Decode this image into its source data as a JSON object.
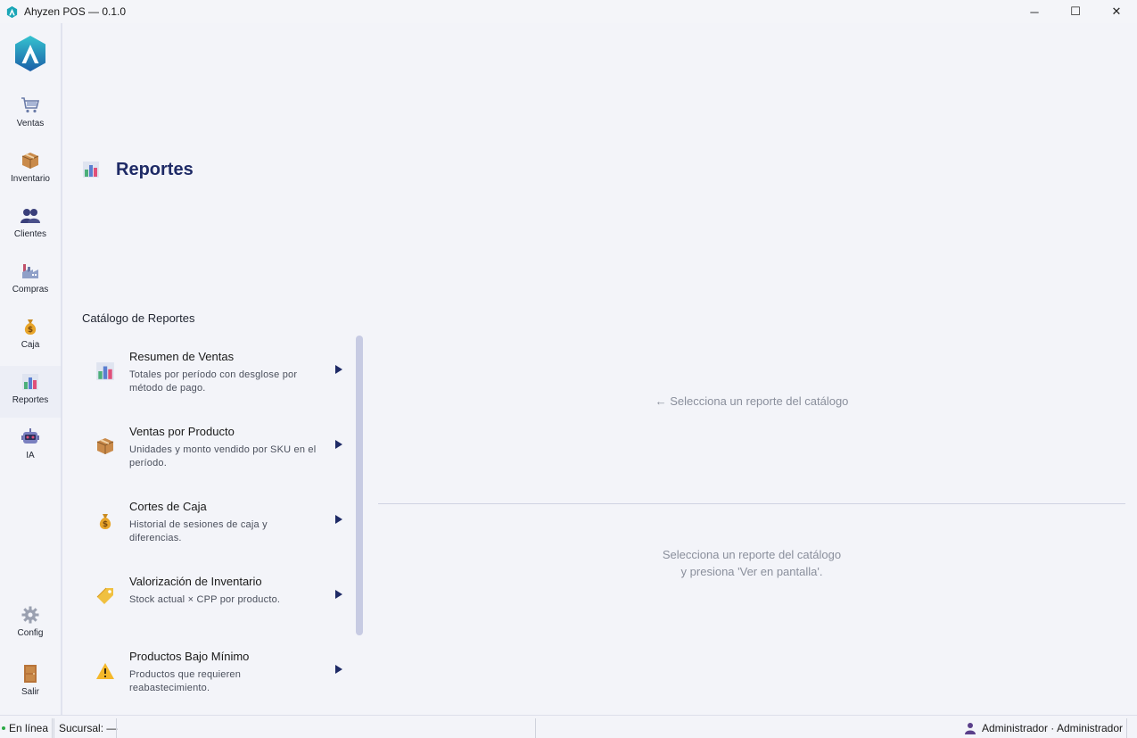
{
  "window": {
    "title": "Ahyzen POS — 0.1.0",
    "minimize": "─",
    "maximize": "☐",
    "close": "✕"
  },
  "sidebar": {
    "items": [
      {
        "label": "Ventas",
        "icon": "cart-icon"
      },
      {
        "label": "Inventario",
        "icon": "package-icon"
      },
      {
        "label": "Clientes",
        "icon": "users-icon"
      },
      {
        "label": "Compras",
        "icon": "factory-icon"
      },
      {
        "label": "Caja",
        "icon": "money-bag-icon"
      },
      {
        "label": "Reportes",
        "icon": "bar-chart-icon",
        "active": true
      },
      {
        "label": "IA",
        "icon": "robot-icon"
      }
    ],
    "bottom_items": [
      {
        "label": "Config",
        "icon": "gear-icon"
      },
      {
        "label": "Salir",
        "icon": "door-icon"
      }
    ]
  },
  "header": {
    "title": "Reportes"
  },
  "catalog": {
    "label": "Catálogo de Reportes",
    "reports": [
      {
        "name": "Resumen de Ventas",
        "desc": "Totales por período con desglose por método de pago.",
        "icon": "bar-chart-icon"
      },
      {
        "name": "Ventas por Producto",
        "desc": "Unidades y monto vendido por SKU en el período.",
        "icon": "package-icon"
      },
      {
        "name": "Cortes de Caja",
        "desc": "Historial de sesiones de caja y diferencias.",
        "icon": "money-bag-icon"
      },
      {
        "name": "Valorización de Inventario",
        "desc": "Stock actual × CPP por producto.",
        "icon": "tag-icon"
      },
      {
        "name": "Productos Bajo Mínimo",
        "desc": "Productos que requieren reabastecimiento.",
        "icon": "warning-icon"
      }
    ]
  },
  "panel": {
    "hint_top": "← Selecciona un reporte del catálogo",
    "hint_bottom_1": "Selecciona un reporte del catálogo",
    "hint_bottom_2": "y presiona 'Ver en pantalla'."
  },
  "status": {
    "online": "En línea",
    "branch": "Sucursal: —",
    "user": "Administrador · Administrador"
  },
  "colors": {
    "accent": "#1e2a66",
    "online": "#2aa845",
    "logo_teal": "#1aa6b7"
  }
}
